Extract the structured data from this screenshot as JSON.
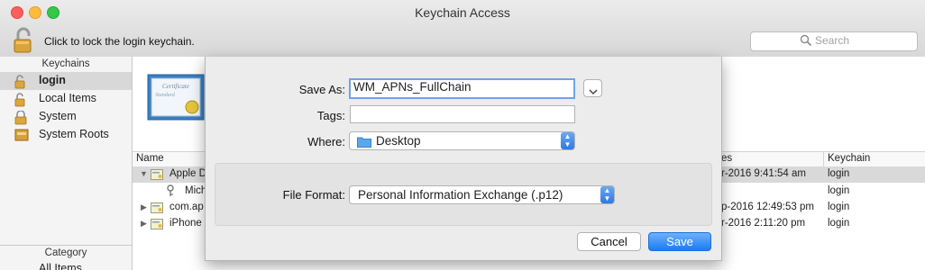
{
  "window": {
    "title": "Keychain Access",
    "lock_text": "Click to lock the login keychain.",
    "search_placeholder": "Search"
  },
  "sidebar": {
    "keychains_header": "Keychains",
    "items": [
      {
        "label": "login",
        "selected": true
      },
      {
        "label": "Local Items"
      },
      {
        "label": "System"
      },
      {
        "label": "System Roots"
      }
    ],
    "category_header": "Category",
    "category_items": [
      {
        "label": "All Items"
      }
    ]
  },
  "table": {
    "headers": {
      "name": "Name",
      "expires": "es",
      "keychain": "Keychain"
    },
    "rows": [
      {
        "name": "Apple D",
        "expires": "r-2016 9:41:54 am",
        "keychain": "login",
        "selected": true,
        "expanded": true
      },
      {
        "name": "Mich",
        "expires": "",
        "keychain": "login",
        "child": true
      },
      {
        "name": "com.ap",
        "expires": "p-2016 12:49:53 pm",
        "keychain": "login"
      },
      {
        "name": "iPhone",
        "expires": "r-2016 2:11:20 pm",
        "keychain": "login"
      }
    ]
  },
  "sheet": {
    "save_as_label": "Save As:",
    "save_as_value": "WM_APNs_FullChain",
    "tags_label": "Tags:",
    "tags_value": "",
    "where_label": "Where:",
    "where_value": "Desktop",
    "file_format_label": "File Format:",
    "file_format_value": "Personal Information Exchange (.p12)",
    "cancel_label": "Cancel",
    "save_label": "Save"
  },
  "colors": {
    "accent": "#1a7cf4",
    "selection": "#d9d9d9"
  }
}
